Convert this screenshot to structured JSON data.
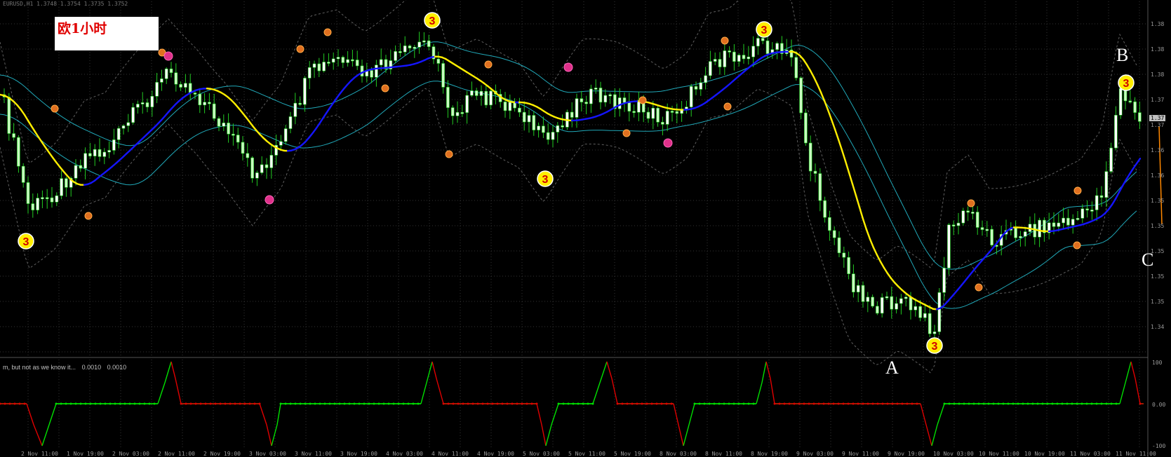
{
  "chart": {
    "title": "欧1小时",
    "ohlc_readout": "EURUSD,H1  1.3748 1.3754 1.3735 1.3752",
    "oscillator_readout": "m, but not as we know it...",
    "oscillator_values": [
      "0.0010",
      "0.0010"
    ],
    "annotations": [
      "A",
      "B",
      "C"
    ],
    "price_axis": [
      "1.38",
      "1.38",
      "1.38",
      "1.37",
      "1.37",
      "1.36",
      "1.36",
      "1.35",
      "1.35",
      "1.35",
      "1.35",
      "1.35",
      "1.34"
    ],
    "current_price": "1.37",
    "osc_axis": [
      "100",
      "0.00",
      "-100"
    ],
    "time_axis": [
      "2 Nov 11:00",
      "1 Nov 19:00",
      "2 Nov 03:00",
      "2 Nov 11:00",
      "2 Nov 19:00",
      "3 Nov 03:00",
      "3 Nov 11:00",
      "3 Nov 19:00",
      "4 Nov 03:00",
      "4 Nov 11:00",
      "4 Nov 19:00",
      "5 Nov 03:00",
      "5 Nov 11:00",
      "5 Nov 19:00",
      "8 Nov 03:00",
      "8 Nov 11:00",
      "8 Nov 19:00",
      "9 Nov 03:00",
      "9 Nov 11:00",
      "9 Nov 19:00",
      "10 Nov 03:00",
      "10 Nov 11:00",
      "10 Nov 19:00",
      "11 Nov 03:00",
      "11 Nov 11:00"
    ],
    "colors": {
      "background": "#000000",
      "candle_up": "#ffffff",
      "candle_down": "#c8ffc0",
      "wick": "#22cc22",
      "ma_rising": "#1515ff",
      "ma_falling": "#ffee00",
      "envelope": "#20a8b8",
      "bollinger": "#606060",
      "osc_up": "#00e000",
      "osc_down": "#e00000",
      "marker_3": "#ffee00",
      "marker_small": "#e07020",
      "marker_pink": "#e0308a"
    },
    "marker_text": "3"
  },
  "chart_data": {
    "type": "candlestick",
    "instrument": "EURUSD",
    "timeframe": "H1",
    "price_range": [
      1.34,
      1.385
    ],
    "oscillator_range": [
      -100,
      100
    ],
    "markers_3": [
      {
        "type": "low",
        "price": 1.352
      },
      {
        "type": "high",
        "price": 1.3842
      },
      {
        "type": "low",
        "price": 1.3615
      },
      {
        "type": "high",
        "price": 1.3832
      },
      {
        "type": "low",
        "price": 1.341
      },
      {
        "type": "high",
        "price": 1.3725
      }
    ]
  }
}
